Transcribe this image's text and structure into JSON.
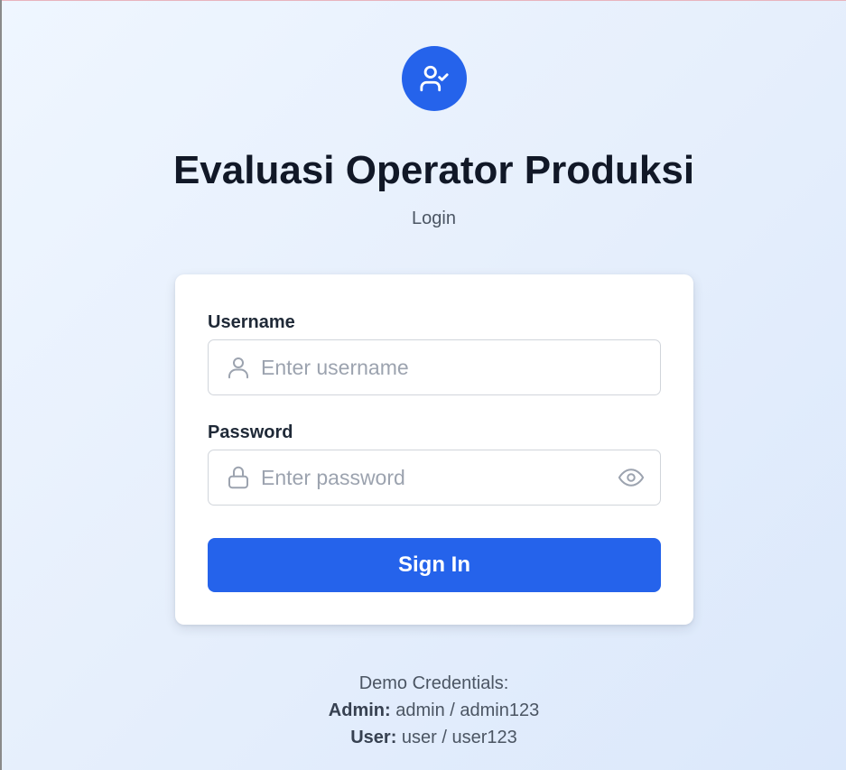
{
  "app": {
    "title": "Evaluasi Operator Produksi",
    "subtitle": "Login"
  },
  "form": {
    "username": {
      "label": "Username",
      "placeholder": "Enter username",
      "value": ""
    },
    "password": {
      "label": "Password",
      "placeholder": "Enter password",
      "value": ""
    },
    "submit_label": "Sign In"
  },
  "demo": {
    "title": "Demo Credentials:",
    "admin_label": "Admin:",
    "admin_value": "admin / admin123",
    "user_label": "User:",
    "user_value": "user / user123"
  },
  "icons": {
    "logo": "user-check-icon",
    "username": "user-icon",
    "password": "lock-icon",
    "toggle": "eye-icon"
  },
  "colors": {
    "primary": "#2563eb",
    "background": "#e6effc",
    "text": "#111827",
    "muted": "#4b5563",
    "placeholder": "#9ca3af",
    "border": "#d1d5db"
  }
}
